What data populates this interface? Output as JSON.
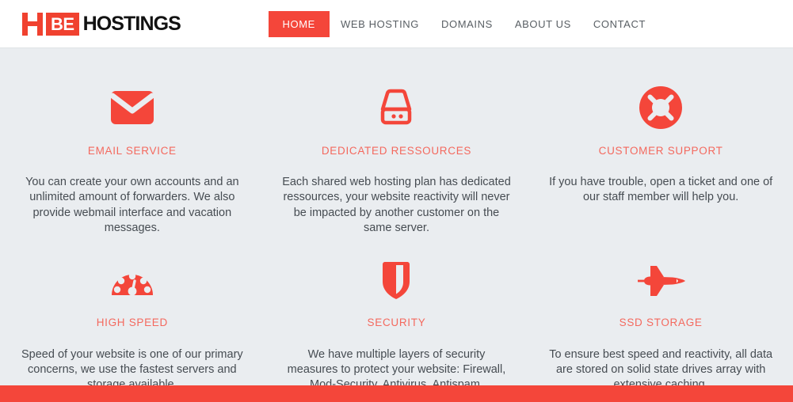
{
  "header": {
    "logo": {
      "mark": "H",
      "badge": "BE",
      "word": "HOSTINGS"
    },
    "nav": [
      {
        "label": "HOME",
        "active": true
      },
      {
        "label": "WEB HOSTING",
        "active": false
      },
      {
        "label": "DOMAINS",
        "active": false
      },
      {
        "label": "ABOUT US",
        "active": false
      },
      {
        "label": "CONTACT",
        "active": false
      }
    ]
  },
  "features": [
    {
      "icon": "envelope-icon",
      "title": "EMAIL SERVICE",
      "text": "You can create your own accounts and an unlimited amount of forwarders. We also provide webmail interface and vacation messages."
    },
    {
      "icon": "server-icon",
      "title": "DEDICATED RESSOURCES",
      "text": "Each shared web hosting plan has dedicated ressources, your website reactivity will never be impacted by another customer on the same server."
    },
    {
      "icon": "lifebuoy-icon",
      "title": "CUSTOMER SUPPORT",
      "text": "If you have trouble, open a ticket and one of our staff member will help you."
    },
    {
      "icon": "speedometer-icon",
      "title": "HIGH SPEED",
      "text": "Speed of your website is one of our primary concerns, we use the fastest servers and storage available."
    },
    {
      "icon": "shield-icon",
      "title": "SECURITY",
      "text": "We have multiple layers of security measures to protect your website: Firewall, Mod-Security, Antivirus, Antispam."
    },
    {
      "icon": "rocket-icon",
      "title": "SSD STORAGE",
      "text": "To ensure best speed and reactivity, all data are stored on solid state drives array with extensive caching."
    }
  ],
  "colors": {
    "accent": "#f4463a",
    "accent_soft": "#f4695e",
    "logo_red": "#f0412f",
    "page_background": "#eaedf0",
    "header_background": "#ffffff",
    "body_text": "#464c52"
  }
}
